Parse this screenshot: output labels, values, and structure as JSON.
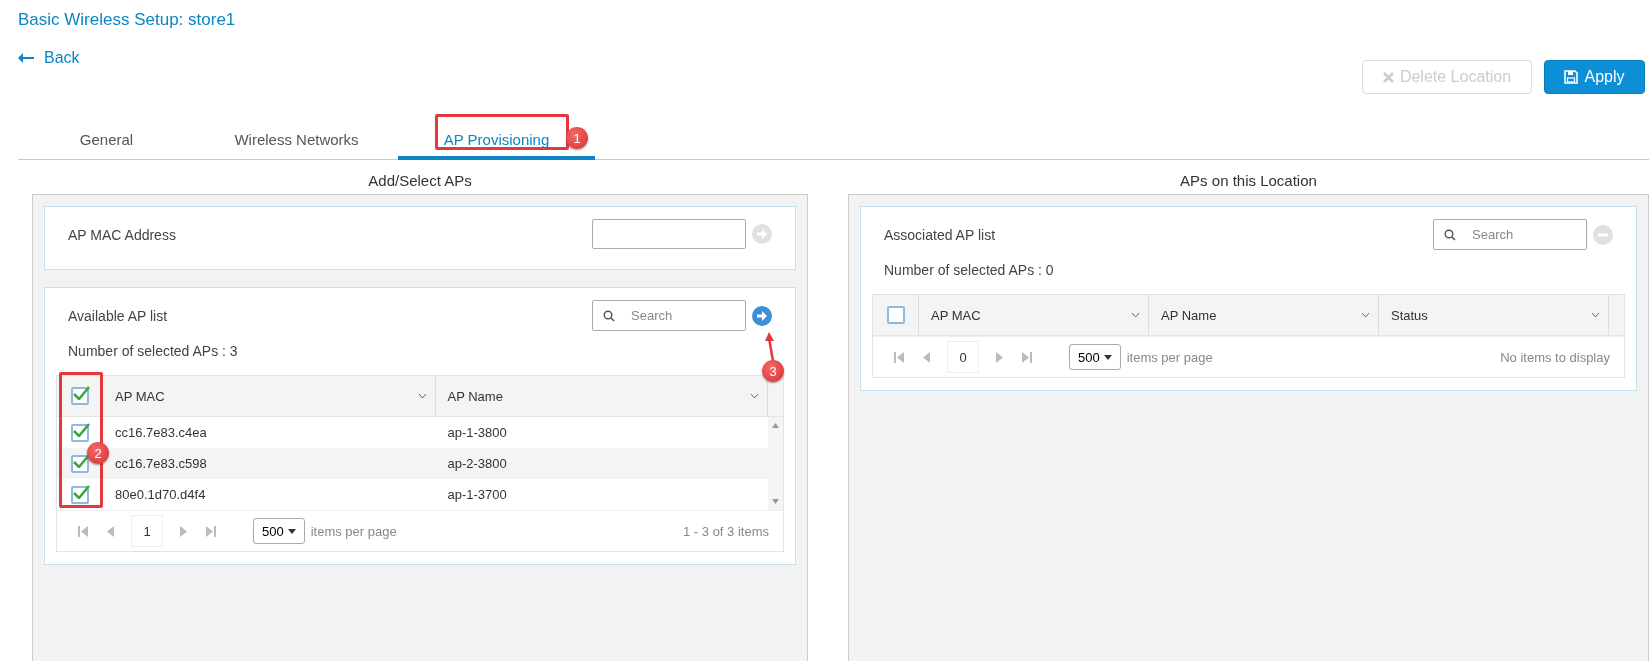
{
  "page": {
    "title": "Basic Wireless Setup: store1",
    "back": "Back"
  },
  "actions": [
    {
      "kind": "delete",
      "label": "Delete Location",
      "disabled": true
    },
    {
      "kind": "apply",
      "label": "Apply",
      "disabled": false
    }
  ],
  "tabs": [
    {
      "label": "General",
      "selected": false
    },
    {
      "label": "Wireless Networks",
      "selected": false
    },
    {
      "label": "AP Provisioning",
      "selected": true,
      "annotation": "1"
    }
  ],
  "panels": [
    {
      "heading": "Add/Select APs",
      "mac_field": {
        "label": "AP MAC Address",
        "submit_disabled": true
      },
      "list": {
        "title": "Available AP list",
        "search": {
          "placeholder": "Search"
        },
        "action": {
          "kind": "add",
          "disabled": false
        },
        "action_annotation": "3",
        "selected_count": "Number of selected APs : 3",
        "checkbox_annotation": "2",
        "all_checked": true,
        "columns": [
          "AP MAC",
          "AP Name"
        ],
        "rows": [
          {
            "cells": [
              "cc16.7e83.c4ea",
              "ap-1-3800"
            ],
            "checked": true
          },
          {
            "cells": [
              "cc16.7e83.c598",
              "ap-2-3800"
            ],
            "checked": true
          },
          {
            "cells": [
              "80e0.1d70.d4f4",
              "ap-1-3700"
            ],
            "checked": true
          }
        ],
        "pager": {
          "page": "1",
          "page_size": "500",
          "per_page_label": "items per page",
          "summary": "1 - 3 of 3 items"
        }
      }
    },
    {
      "heading": "APs on this Location",
      "list": {
        "title": "Associated AP list",
        "search": {
          "placeholder": "Search"
        },
        "action": {
          "kind": "remove",
          "disabled": true
        },
        "selected_count": "Number of selected APs : 0",
        "all_checked": false,
        "columns": [
          "AP MAC",
          "AP Name",
          "Status"
        ],
        "pager": {
          "page": "0",
          "page_size": "500",
          "per_page_label": "items per page",
          "summary": "No items to display"
        }
      }
    }
  ]
}
